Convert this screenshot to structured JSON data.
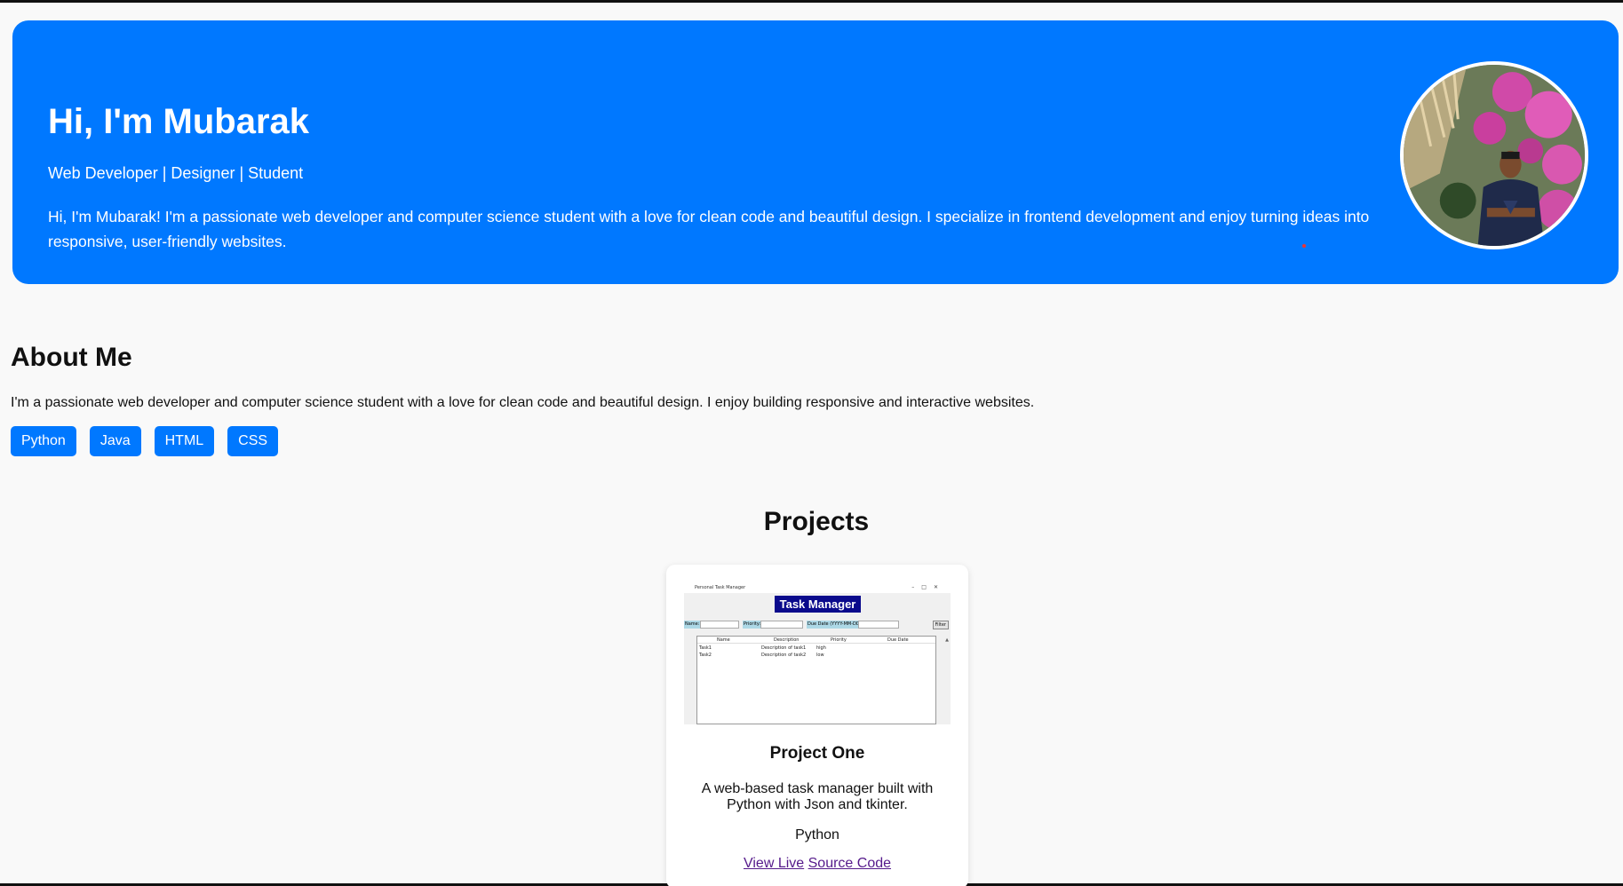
{
  "hero": {
    "title": "Hi, I'm Mubarak",
    "roles": "Web Developer | Designer | Student",
    "bio": "Hi, I'm Mubarak! I'm a passionate web developer and computer science student with a love for clean code and beautiful design. I specialize in frontend development and enjoy turning ideas into responsive, user-friendly websites.",
    "bg_color": "#0078ff"
  },
  "about": {
    "title": "About Me",
    "text": "I'm a passionate web developer and computer science student with a love for clean code and beautiful design. I enjoy building responsive and interactive websites.",
    "skills": [
      "Python",
      "Java",
      "HTML",
      "CSS"
    ]
  },
  "projects": {
    "title": "Projects",
    "items": [
      {
        "title": "Project One",
        "description": "A web-based task manager built with Python with Json and tkinter.",
        "tech": "Python",
        "live_label": "View Live",
        "source_label": "Source Code",
        "screenshot": {
          "window_title": "Personal Task Manager",
          "heading": "Task Manager",
          "form_labels": [
            "Name:",
            "Priority:",
            "Due Date (YYYY-MM-DD):"
          ],
          "filter_label": "Filter",
          "columns": [
            "Name",
            "Description",
            "Priority",
            "Due Date"
          ],
          "rows": [
            [
              "Task1",
              "Description of task1",
              "high",
              ""
            ],
            [
              "Task2",
              "Description of task2",
              "low",
              ""
            ]
          ]
        }
      }
    ]
  },
  "colors": {
    "accent": "#0078ff",
    "link_visited": "#551a8b"
  }
}
